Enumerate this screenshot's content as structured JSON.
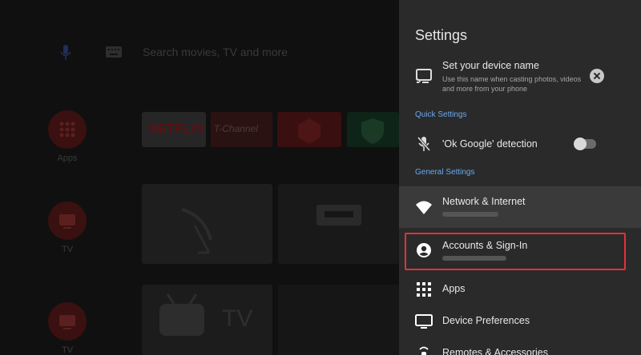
{
  "home": {
    "search_placeholder": "Search movies, TV and more",
    "rail": [
      {
        "label": "Apps"
      },
      {
        "label": "TV"
      },
      {
        "label": "TV"
      }
    ],
    "tiles": {
      "netflix": "NETFLIX",
      "tchannel": "T-Channel",
      "tv_word": "TV"
    }
  },
  "settings": {
    "title": "Settings",
    "device_name": {
      "title": "Set your device name",
      "subtitle_line1": "Use this name when casting photos, videos",
      "subtitle_line2": "and more from your phone"
    },
    "quick_settings_header": "Quick Settings",
    "ok_google": {
      "title": "'Ok Google' detection",
      "enabled": false
    },
    "general_settings_header": "General Settings",
    "items": [
      {
        "title": "Network & Internet"
      },
      {
        "title": "Accounts & Sign-In"
      },
      {
        "title": "Apps"
      },
      {
        "title": "Device Preferences"
      },
      {
        "title": "Remotes & Accessories"
      }
    ],
    "colors": {
      "panel_bg": "#2a2a2a",
      "section_header": "#6aa8f2",
      "selected_row": "#3a3a3a",
      "highlight_border": "#e0313a"
    }
  }
}
